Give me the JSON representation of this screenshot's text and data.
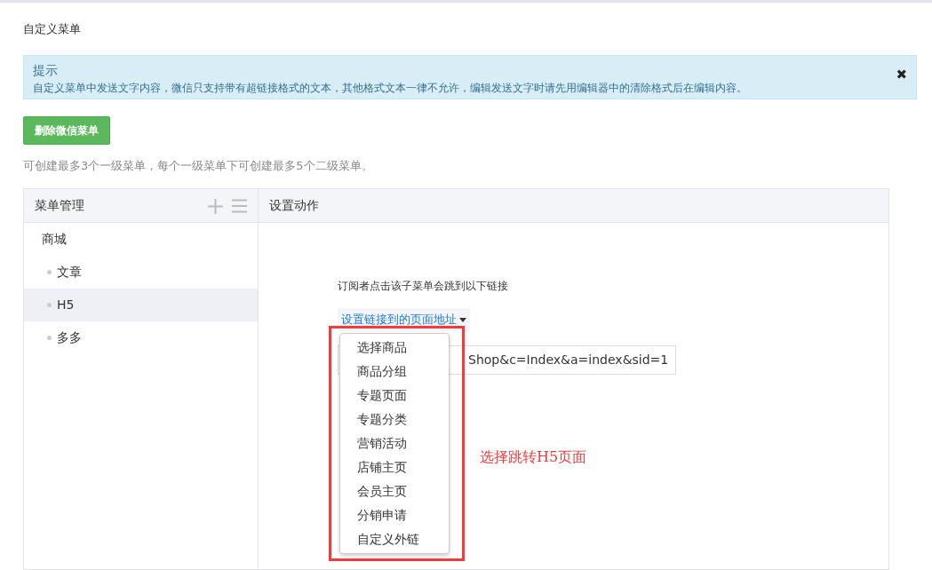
{
  "page_title": "自定义菜单",
  "alert": {
    "title": "提示",
    "text": "自定义菜单中发送文字内容，微信只支持带有超链接格式的文本，其他格式文本一律不允许，编辑发送文字时请先用编辑器中的清除格式后在编辑内容。",
    "close": "✖"
  },
  "delete_button": "删除微信菜单",
  "hint": "可创建最多3个一级菜单，每个一级菜单下可创建最多5个二级菜单。",
  "menu_panel": {
    "title": "菜单管理",
    "items": [
      {
        "label": "商城",
        "selected": false,
        "children": [
          {
            "label": "文章",
            "selected": false
          },
          {
            "label": "H5",
            "selected": true
          },
          {
            "label": "多多",
            "selected": false
          }
        ]
      }
    ]
  },
  "action_panel": {
    "title": "设置动作",
    "description": "订阅者点击该子菜单会跳到以下链接",
    "link_dropdown": "设置链接到的页面地址",
    "url_value": "Shop&c=Index&a=index&sid=1",
    "dropdown_items": [
      "选择商品",
      "商品分组",
      "专题页面",
      "专题分类",
      "营销活动",
      "店铺主页",
      "会员主页",
      "分销申请",
      "自定义外链"
    ]
  },
  "annotation": "选择跳转H5页面"
}
